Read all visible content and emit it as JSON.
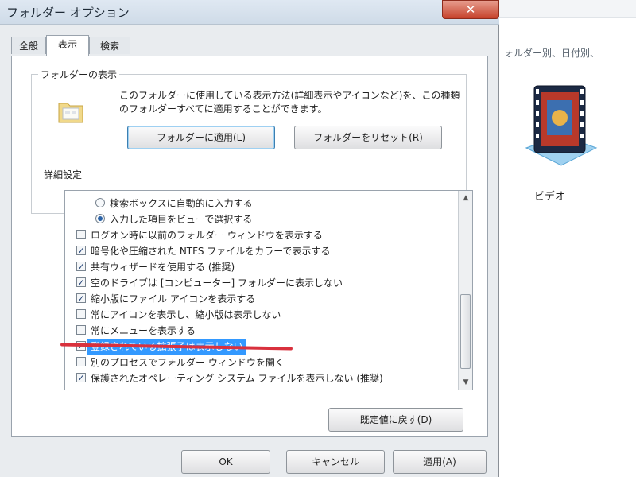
{
  "window": {
    "title": "フォルダー オプション",
    "close_glyph": "✕"
  },
  "tabs": [
    {
      "label": "全般"
    },
    {
      "label": "表示"
    },
    {
      "label": "検索"
    }
  ],
  "folder_view": {
    "group_label": "フォルダーの表示",
    "description": "このフォルダーに使用している表示方法(詳細表示やアイコンなど)を、この種類のフォルダーすべてに適用することができます。",
    "apply_button": "フォルダーに適用(L)",
    "reset_button": "フォルダーをリセット(R)"
  },
  "advanced": {
    "label": "詳細設定",
    "items": [
      {
        "text": "検索ボックスに自動的に入力する",
        "type": "radio",
        "checked": false
      },
      {
        "text": "入力した項目をビューで選択する",
        "type": "radio",
        "checked": true
      },
      {
        "text": "ログオン時に以前のフォルダー ウィンドウを表示する",
        "type": "checkbox",
        "checked": false
      },
      {
        "text": "暗号化や圧縮された NTFS ファイルをカラーで表示する",
        "type": "checkbox",
        "checked": true
      },
      {
        "text": "共有ウィザードを使用する (推奨)",
        "type": "checkbox",
        "checked": true
      },
      {
        "text": "空のドライブは [コンピューター] フォルダーに表示しない",
        "type": "checkbox",
        "checked": true
      },
      {
        "text": "縮小版にファイル アイコンを表示する",
        "type": "checkbox",
        "checked": true
      },
      {
        "text": "常にアイコンを表示し、縮小版は表示しない",
        "type": "checkbox",
        "checked": false
      },
      {
        "text": "常にメニューを表示する",
        "type": "checkbox",
        "checked": false
      },
      {
        "text": "登録されている拡張子は表示しない",
        "type": "checkbox",
        "checked": true,
        "selected": true
      },
      {
        "text": "別のプロセスでフォルダー ウィンドウを開く",
        "type": "checkbox",
        "checked": false
      },
      {
        "text": "保護されたオペレーティング システム ファイルを表示しない (推奨)",
        "type": "checkbox",
        "checked": true
      }
    ],
    "restore_button": "既定値に戻す(D)"
  },
  "footer": {
    "ok_button": "OK",
    "cancel_button": "キャンセル",
    "apply_button": "適用(A)"
  },
  "explorer": {
    "description": "ォルダー別、日付別、",
    "video_label": "ビデオ"
  },
  "colors": {
    "selection": "#3399ff",
    "annotation_underline": "#d9313d",
    "close_button": "#c6412b"
  }
}
